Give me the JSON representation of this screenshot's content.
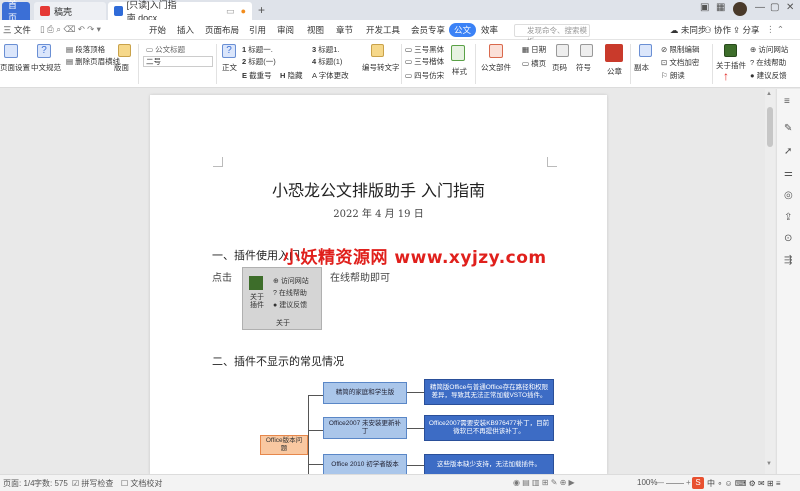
{
  "tabs": {
    "home": "首页",
    "doc1": "稿壳",
    "doc2": "[只读]入门指南.docx",
    "new_tab": "+"
  },
  "menu": {
    "file": "三 文件",
    "items": [
      "开始",
      "插入",
      "页面布局",
      "引用",
      "审阅",
      "视图",
      "章节",
      "开发工具",
      "会员专享",
      "公文",
      "效率"
    ],
    "active": "公文",
    "search_placeholder": "发现命令、搜索模板",
    "unsync": "未同步",
    "collab": "协作",
    "share": "分享"
  },
  "ribbon": {
    "page_setup": "页面设置",
    "chinese_layout": "中文规范",
    "para_top": "段落顶格",
    "remove_header_line": "删除页眉横线",
    "layout": "版面",
    "official_title": "公文标题",
    "font_size_value": "二号",
    "body": "正文",
    "heading1": "标题一.",
    "heading1b": "标题(一)",
    "heading_bold": "截重号",
    "hidden": "隐藏",
    "heading3": "标题1.",
    "heading4": "标题(1)",
    "font_change": "字体更改",
    "num_text": "编号转文字",
    "font_fs": "三号黑体",
    "font_kai": "三号楷体",
    "font_fang": "四号仿宋",
    "style": "样式",
    "official_parts": "公文部件",
    "date": "日期",
    "landscape": "横页",
    "page_num": "页码",
    "symbol": "符号",
    "seal": "公章",
    "copy": "副本",
    "restrict_edit": "限制编辑",
    "doc_encrypt": "文档加密",
    "proofread": "朗读",
    "about_plugin": "关于插件",
    "visit_site": "访问网站",
    "online_help": "在线帮助",
    "feedback": "建议反馈"
  },
  "document": {
    "title": "小恐龙公文排版助手  入门指南",
    "date": "2022 年 4 月 19 日",
    "section1": "一、插件使用入门",
    "body1_prefix": "点击",
    "body1_suffix": "在线帮助即可",
    "section2": "二、插件不显示的常见情况",
    "watermark": "小妖精资源网 www.xyjzy.com",
    "popup": {
      "about": "关于插件",
      "visit": "访问网站",
      "help": "在线帮助",
      "feedback": "建议反馈",
      "group_label": "关于"
    },
    "diagram": {
      "root": "Office版本问题",
      "mid1": "精简的家庭和学生版",
      "mid2": "Office2007 未安装更新补丁",
      "mid3": "Office 2010 初学者版本",
      "leaf1": "精简版Office与普通Office存在路径和权限差异，导致其无法正常加载VSTO插件。",
      "leaf2": "Office2007需要安装KB976477补丁，目前微软已不再提供该补丁。",
      "leaf3": "这些版本缺少支持，无法加载插件。"
    }
  },
  "status": {
    "page": "页面: 1/4",
    "words": "字数: 575",
    "spell": "拼写检查",
    "proof": "文档校对",
    "zoom": "100%"
  },
  "colors": {
    "accent": "#3b82f6",
    "home_tab": "#3b6fd6",
    "watermark": "#e0201c"
  }
}
